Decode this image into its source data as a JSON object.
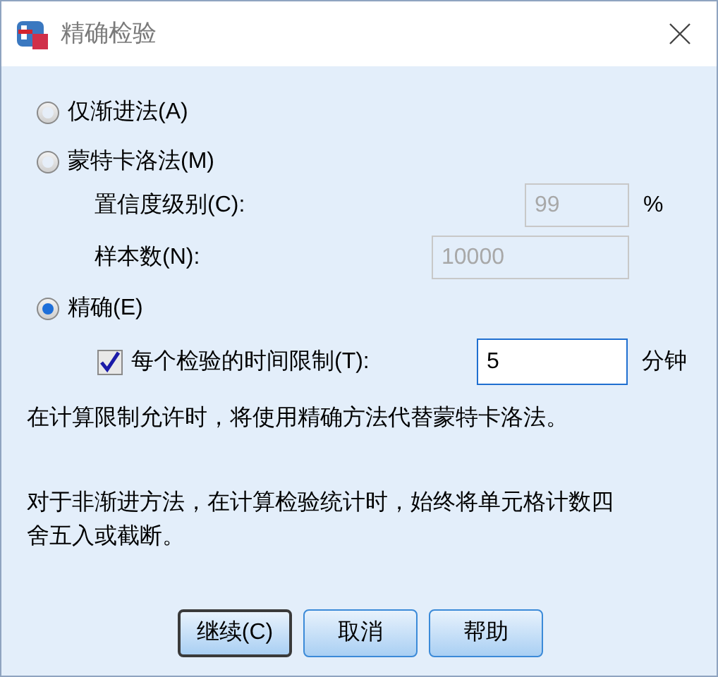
{
  "window": {
    "title": "精确检验"
  },
  "methods": [
    {
      "label": "仅渐进法(A)",
      "selected": false
    },
    {
      "label": "蒙特卡洛法(M)",
      "selected": false
    },
    {
      "label": "精确(E)",
      "selected": true
    }
  ],
  "monte_carlo": {
    "confidence_label": "置信度级别(C):",
    "confidence_value": "99",
    "confidence_unit": "%",
    "samples_label": "样本数(N):",
    "samples_value": "10000",
    "disabled": true
  },
  "time_limit": {
    "label": "每个检验的时间限制(T):",
    "checked": true,
    "value": "5",
    "unit": "分钟"
  },
  "notes": [
    "在计算限制允许时，将使用精确方法代替蒙特卡洛法。",
    "对于非渐进方法，在计算检验统计时，始终将单元格计数四舍五入或截断。"
  ],
  "buttons": [
    {
      "label": "继续(C)",
      "default": true
    },
    {
      "label": "取消",
      "default": false
    },
    {
      "label": "帮助",
      "default": false
    }
  ]
}
